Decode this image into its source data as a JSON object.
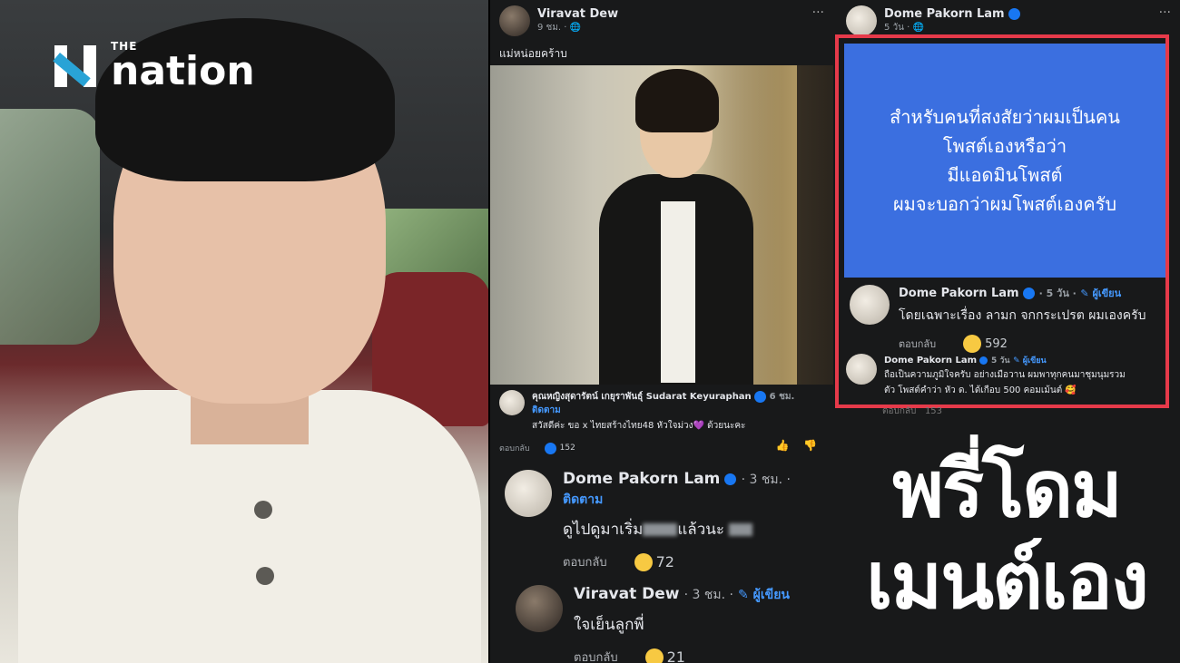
{
  "logo": {
    "the": "THE",
    "name": "nation"
  },
  "post": {
    "author": "Viravat Dew",
    "time": "9 ชม. · ",
    "caption": "แม่หน่อยคร้าบ"
  },
  "comment1": {
    "author": "คุณหญิงสุดารัตน์ เกยุราพันธุ์ Sudarat Keyuraphan",
    "time": "6 ชม.",
    "follow": "ติดตาม",
    "text": "สวัสดีค่ะ ขอ x ไทยสร้างไทย48 หัวใจม่วง💜 ด้วยนะคะ",
    "reply": "ตอบกลับ",
    "reactions": "152"
  },
  "comment2": {
    "author": "Dome Pakorn Lam",
    "time": "· 3 ชม. ·",
    "follow": "ติดตาม",
    "text_a": "ดูไปดูมาเริ่ม",
    "text_b": "แล้วนะ",
    "reply": "ตอบกลับ",
    "reactions": "72"
  },
  "comment3": {
    "author": "Viravat Dew",
    "time": "· 3 ชม. ·",
    "role": "ผู้เขียน",
    "text": "ใจเย็นลูกพี่",
    "reply": "ตอบกลับ",
    "reactions": "21"
  },
  "right_post": {
    "author": "Dome Pakorn Lam",
    "time": "5 วัน · ",
    "card_lines": [
      "สำหรับคนที่สงสัยว่าผมเป็นคน",
      "โพสต์เองหรือว่า",
      "มีแอดมินโพสต์",
      "ผมจะบอกว่าผมโพสต์เองครับ"
    ]
  },
  "right_comment1": {
    "author": "Dome Pakorn Lam",
    "time": "· 5 วัน ·",
    "role": "ผู้เขียน",
    "text": "โดยเฉพาะเรื่อง ลามก จกกระเปรต ผมเองครับ",
    "reply": "ตอบกลับ",
    "reactions": "592"
  },
  "right_comment2": {
    "author": "Dome Pakorn Lam",
    "time": "5 วัน",
    "role": "ผู้เขียน",
    "text_line1": "ถือเป็นความภูมิใจครับ อย่างเมื่อวาน ผมพาทุกคนมาชุมนุมรวม",
    "text_line2": "ตัว โพสต์คำว่า หัว ด. ได้เกือบ 500 คอมเม้นต์ 🥰"
  },
  "right_under": {
    "reply": "ตอบกลับ",
    "reactions": "153"
  },
  "headline": {
    "line1": "พรี่โดม",
    "line2": "เมนต์เอง"
  },
  "colors": {
    "highlight": "#e63a4a",
    "card": "#3b6fe0",
    "link": "#4599ff"
  }
}
